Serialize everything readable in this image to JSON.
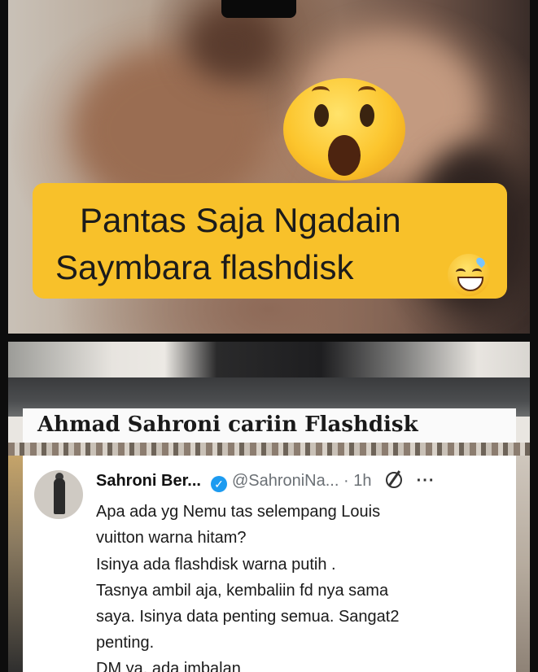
{
  "meme": {
    "caption_line1": "Pantas Saja Ngadain",
    "caption_line2": "Saymbara flashdisk",
    "emoji_top": "shocked-face",
    "emoji_caption": "grinning-sweat-face",
    "caption_bg_color": "#f8c12a"
  },
  "headline": {
    "text": "Ahmad Sahroni cariin Flashdisk"
  },
  "tweet": {
    "name": "Sahroni Ber...",
    "handle": "@SahroniNa...",
    "separator": "·",
    "time": "1h",
    "lines": [
      "Apa ada yg Nemu tas selempang Louis",
      "vuitton warna hitam?",
      "Isinya ada flashdisk warna putih .",
      "Tasnya ambil aja, kembaliin fd nya sama",
      "saya. Isinya data penting semua. Sangat2",
      "penting.",
      "DM ya, ada imbalan"
    ],
    "verified_color": "#1d9bf0"
  }
}
